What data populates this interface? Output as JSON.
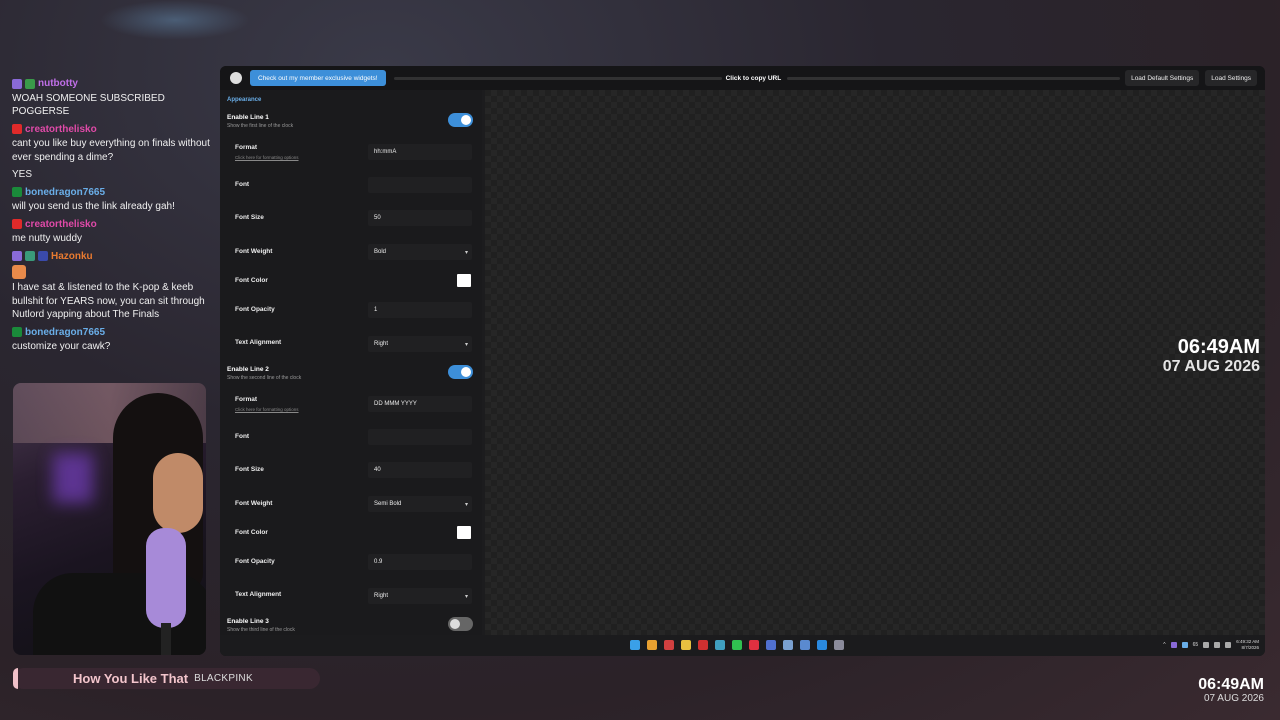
{
  "chat": [
    {
      "user": "nutbotty",
      "color": "#c06fe8",
      "badges": [
        "#8a6ad8",
        "#3a9a4a"
      ],
      "text": "WOAH SOMEONE SUBSCRIBED POGGERSE"
    },
    {
      "user": "creatorthelisko",
      "color": "#e04aa8",
      "badges": [
        "#e02a2a"
      ],
      "text": "cant you like buy everything on finals without ever spending a dime?"
    },
    {
      "user": "",
      "color": "",
      "badges": [],
      "text": "YES"
    },
    {
      "user": "bonedragon7665",
      "color": "#6aaee8",
      "badges": [
        "#1a8a3a"
      ],
      "text": "will you send us the link already gah!"
    },
    {
      "user": "creatorthelisko",
      "color": "#e04aa8",
      "badges": [
        "#e02a2a"
      ],
      "text": "me nutty wuddy"
    },
    {
      "user": "Hazonku",
      "color": "#e87a30",
      "badges": [
        "#8a6ad8",
        "#3a9a7a",
        "#3a4aaa"
      ],
      "text": "I have sat & listened to the K-pop & keeb bullshit for YEARS now, you can sit through Nutlord yapping about The Finals",
      "emote": true
    },
    {
      "user": "bonedragon7665",
      "color": "#6aaee8",
      "badges": [
        "#1a8a3a"
      ],
      "text": "customize your cawk?"
    }
  ],
  "now_playing": {
    "title": "How You Like That",
    "artist": "BLACKPINK"
  },
  "overlay_clock": {
    "time": "06:49AM",
    "date": "07 AUG 2026"
  },
  "topbar": {
    "member_button": "Check out my member exclusive widgets!",
    "copy_url": "Click to copy URL",
    "load_default": "Load Default Settings",
    "load_settings": "Load Settings"
  },
  "panel": {
    "section": "Appearance",
    "line1": {
      "title": "Enable Line 1",
      "subtitle": "Show the first line of the clock",
      "enabled": true,
      "format_label": "Format",
      "format_link": "Click here for formatting options",
      "format_value": "hh:mmA",
      "font_label": "Font",
      "font_value": "",
      "size_label": "Font Size",
      "size_value": "50",
      "weight_label": "Font Weight",
      "weight_value": "Bold",
      "color_label": "Font Color",
      "color_value": "#ffffff",
      "opacity_label": "Font Opacity",
      "opacity_value": "1",
      "align_label": "Text Alignment",
      "align_value": "Right"
    },
    "line2": {
      "title": "Enable Line 2",
      "subtitle": "Show the second line of the clock",
      "enabled": true,
      "format_label": "Format",
      "format_link": "Click here for formatting options",
      "format_value": "DD MMM YYYY",
      "font_label": "Font",
      "font_value": "",
      "size_label": "Font Size",
      "size_value": "40",
      "weight_label": "Font Weight",
      "weight_value": "Semi Bold",
      "color_label": "Font Color",
      "color_value": "#ffffff",
      "opacity_label": "Font Opacity",
      "opacity_value": "0.9",
      "align_label": "Text Alignment",
      "align_value": "Right"
    },
    "line3": {
      "title": "Enable Line 3",
      "subtitle": "Show the third line of the clock",
      "enabled": false
    }
  },
  "preview": {
    "line1": "06:49AM",
    "line2": "07 AUG 2026"
  },
  "taskbar": {
    "icons": [
      {
        "name": "start-icon",
        "color": "#3aa0e8"
      },
      {
        "name": "chrome-icon",
        "color": "#e8a030"
      },
      {
        "name": "chrome-alt-icon",
        "color": "#d04040"
      },
      {
        "name": "folder-icon",
        "color": "#e8c040"
      },
      {
        "name": "app-icon",
        "color": "#d03030"
      },
      {
        "name": "edge-icon",
        "color": "#40a0c0"
      },
      {
        "name": "spotify-icon",
        "color": "#30c050"
      },
      {
        "name": "music-icon",
        "color": "#e03040"
      },
      {
        "name": "code-icon",
        "color": "#5070d0"
      },
      {
        "name": "app2-icon",
        "color": "#7aa0d0"
      },
      {
        "name": "app3-icon",
        "color": "#5a8ad0"
      },
      {
        "name": "vscode-icon",
        "color": "#2a8ae0"
      },
      {
        "name": "settings-icon",
        "color": "#8a8a9a"
      }
    ],
    "tray_temp": "65",
    "tray_time": "6:49:32 AM",
    "tray_date": "8/7/2026"
  }
}
